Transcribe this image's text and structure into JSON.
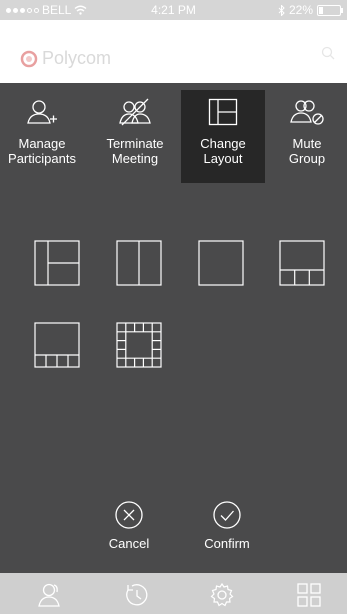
{
  "status_bar": {
    "carrier": "BELL",
    "time": "4:21 PM",
    "battery_percent": "22%",
    "battery_level": 0.22
  },
  "header": {
    "brand": "Polycom",
    "search_icon": "search-icon"
  },
  "toolbar": {
    "items": [
      {
        "label_line1": "Manage",
        "label_line2": "Participants",
        "icon": "add-participant-icon"
      },
      {
        "label_line1": "Terminate",
        "label_line2": "Meeting",
        "icon": "end-meeting-icon"
      },
      {
        "label_line1": "Change",
        "label_line2": "Layout",
        "icon": "layout-icon",
        "active": true
      },
      {
        "label_line1": "Mute",
        "label_line2": "Group",
        "icon": "mute-group-icon"
      }
    ]
  },
  "layout_options": [
    {
      "name": "layout-one-plus-two"
    },
    {
      "name": "layout-two-columns"
    },
    {
      "name": "layout-single"
    },
    {
      "name": "layout-one-plus-three"
    },
    {
      "name": "layout-one-plus-four"
    },
    {
      "name": "layout-grid-ring"
    }
  ],
  "actions": {
    "cancel": "Cancel",
    "confirm": "Confirm"
  },
  "tabbar": {
    "items": [
      "contacts-icon",
      "history-icon",
      "settings-icon",
      "grid-apps-icon"
    ]
  },
  "colors": {
    "background": "#4a4a4b",
    "active_tile": "#272727",
    "tabbar": "#cfcfcf",
    "brand_accent": "#e8a0a0"
  }
}
